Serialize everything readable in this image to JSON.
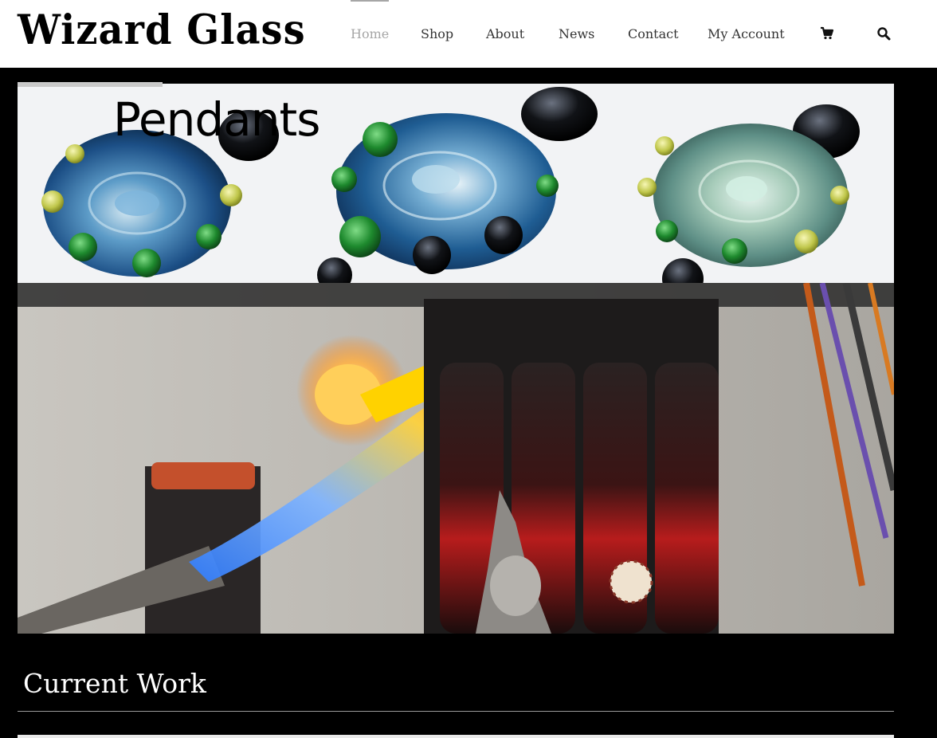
{
  "site": {
    "logo_text": "Wizard Glass"
  },
  "nav": {
    "items": [
      {
        "label": "Home",
        "active": true
      },
      {
        "label": "Shop",
        "active": false
      },
      {
        "label": "About",
        "active": false
      },
      {
        "label": "News",
        "active": false
      },
      {
        "label": "Contact",
        "active": false
      },
      {
        "label": "My Account",
        "active": false
      }
    ],
    "cart_icon": "shopping-cart-icon",
    "search_icon": "search-icon"
  },
  "hero": {
    "title": "Pendants",
    "image": "glass-pendants-photo"
  },
  "photo": {
    "image": "torch-flame-workbench-photo"
  },
  "section": {
    "title": "Current Work"
  },
  "colors": {
    "header_bg": "#ffffff",
    "page_bg": "#000000",
    "nav_text": "#333333",
    "nav_active": "#a6a6a6",
    "section_title": "#ffffff"
  }
}
